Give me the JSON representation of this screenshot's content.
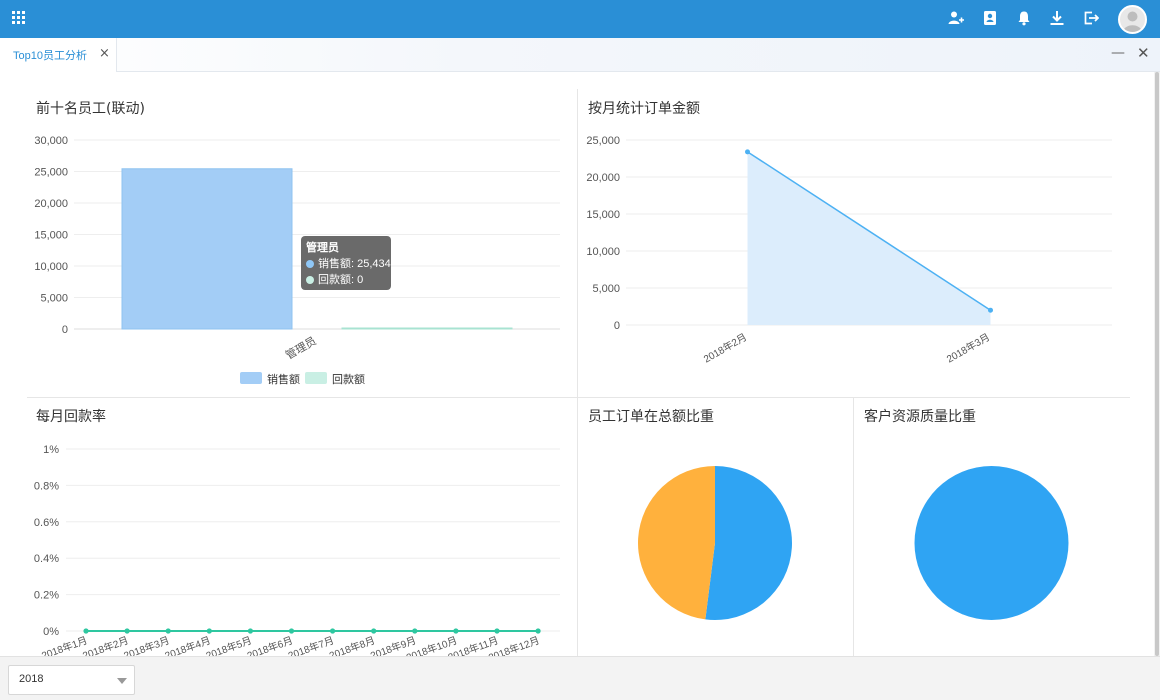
{
  "tabs": [
    {
      "label": "Top10员工分析",
      "active": true
    }
  ],
  "topbar_icons": [
    "apps-grid-icon",
    "add-user-icon",
    "contacts-icon",
    "bell-icon",
    "download-icon",
    "logout-icon",
    "avatar"
  ],
  "colors": {
    "header": "#2a8fd6",
    "bar_sales": "#a3cdf6",
    "bar_payment": "#c9efe4",
    "line_blue": "#4db1f3",
    "area_blue": "#dcedfc",
    "line_green": "#2ec7a0",
    "pie_blue": "#2fa4f3",
    "pie_orange": "#ffb13d"
  },
  "panels": {
    "top10": {
      "title": "前十名员工(联动)"
    },
    "monthly_amount": {
      "title": "按月统计订单金额"
    },
    "monthly_rate": {
      "title": "每月回款率"
    },
    "employee_share": {
      "title": "员工订单在总额比重"
    },
    "customer_quality": {
      "title": "客户资源质量比重"
    }
  },
  "tooltip": {
    "title": "管理员",
    "rows": [
      {
        "label": "销售额: 25,434",
        "color": "#8fc7f6"
      },
      {
        "label": "回款额: 0",
        "color": "#c9efe4"
      }
    ]
  },
  "legend": {
    "sales": "销售额",
    "payment": "回款额"
  },
  "filters": {
    "year": "2018"
  },
  "chart_data": [
    {
      "type": "bar",
      "title": "前十名员工(联动)",
      "categories": [
        "管理员"
      ],
      "series": [
        {
          "name": "销售额",
          "values": [
            25434
          ]
        },
        {
          "name": "回款额",
          "values": [
            0
          ]
        }
      ],
      "ylim": [
        0,
        30000
      ],
      "yticks": [
        "0",
        "5,000",
        "10,000",
        "15,000",
        "20,000",
        "25,000",
        "30,000"
      ],
      "legend_position": "bottom-center"
    },
    {
      "type": "area",
      "title": "按月统计订单金额",
      "x": [
        "2018年2月",
        "2018年3月"
      ],
      "values": [
        23400,
        2000
      ],
      "ylim": [
        0,
        25000
      ],
      "yticks": [
        "0",
        "5,000",
        "10,000",
        "15,000",
        "20,000",
        "25,000"
      ]
    },
    {
      "type": "line",
      "title": "每月回款率",
      "x": [
        "2018年1月",
        "2018年2月",
        "2018年3月",
        "2018年4月",
        "2018年5月",
        "2018年6月",
        "2018年7月",
        "2018年8月",
        "2018年9月",
        "2018年10月",
        "2018年11月",
        "2018年12月"
      ],
      "values": [
        0,
        0,
        0,
        0,
        0,
        0,
        0,
        0,
        0,
        0,
        0,
        0
      ],
      "ylim": [
        0,
        1
      ],
      "yticks": [
        "0%",
        "0.2%",
        "0.4%",
        "0.6%",
        "0.8%",
        "1%"
      ]
    },
    {
      "type": "pie",
      "title": "员工订单在总额比重",
      "values": [
        52,
        48
      ],
      "colors": [
        "#2fa4f3",
        "#ffb13d"
      ]
    },
    {
      "type": "pie",
      "title": "客户资源质量比重",
      "values": [
        100
      ],
      "colors": [
        "#2fa4f3"
      ]
    }
  ]
}
